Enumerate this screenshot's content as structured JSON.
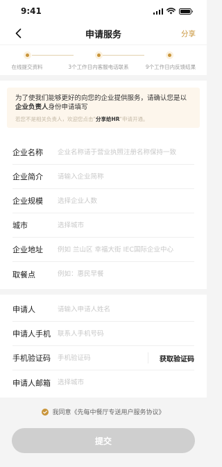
{
  "status_bar": {
    "time": "9:41"
  },
  "nav": {
    "title": "申请服务",
    "share_label": "分享"
  },
  "steps": [
    {
      "label": "在线提交资料"
    },
    {
      "label": "3个工作日内客服电话联系"
    },
    {
      "label": "9个工作日内反馈结果"
    }
  ],
  "notice": {
    "line_part1": "为了使我们能够更好的向您的企业提供服务，请确认您是以",
    "line_bold": "企业负责人",
    "line_part2": "身份申请填写",
    "sub_part1": "若您不是相关负责人，欢迎您点击\"",
    "sub_link": "分享给HR",
    "sub_part2": "\"申请开通。"
  },
  "company_form": [
    {
      "label": "企业名称",
      "placeholder": "企业名称请于营业执照注册名称保持一致",
      "value": ""
    },
    {
      "label": "企业简介",
      "placeholder": "请输入企业简称",
      "value": ""
    },
    {
      "label": "企业规模",
      "placeholder": "选择企业人数",
      "value": ""
    },
    {
      "label": "城市",
      "placeholder": "选择城市",
      "value": ""
    },
    {
      "label": "企业地址",
      "placeholder": "例如 兰山区 幸福大街 IEC国际企业中心",
      "value": ""
    },
    {
      "label": "取餐点",
      "placeholder": "例如：惠民早餐",
      "value": ""
    }
  ],
  "applicant_form": [
    {
      "label": "申请人",
      "placeholder": "请输入申请人姓名",
      "value": ""
    },
    {
      "label": "申请人手机",
      "placeholder": "联系人手机号码",
      "value": ""
    },
    {
      "label": "手机验证码",
      "placeholder": "手机验证码",
      "value": "",
      "action": "获取验证码"
    },
    {
      "label": "申请人邮箱",
      "placeholder": "选择城市",
      "value": ""
    }
  ],
  "agreement": {
    "text": "我同意《先每中餐厅专送用户服务协议》",
    "checked": true
  },
  "submit_label": "提交",
  "colors": {
    "accent": "#c9953b",
    "notice_bg": "#fdf6ec",
    "disabled_button": "#cfcfcf"
  },
  "icons": {
    "back": "chevron-left-icon",
    "check": "check-circle-icon"
  }
}
